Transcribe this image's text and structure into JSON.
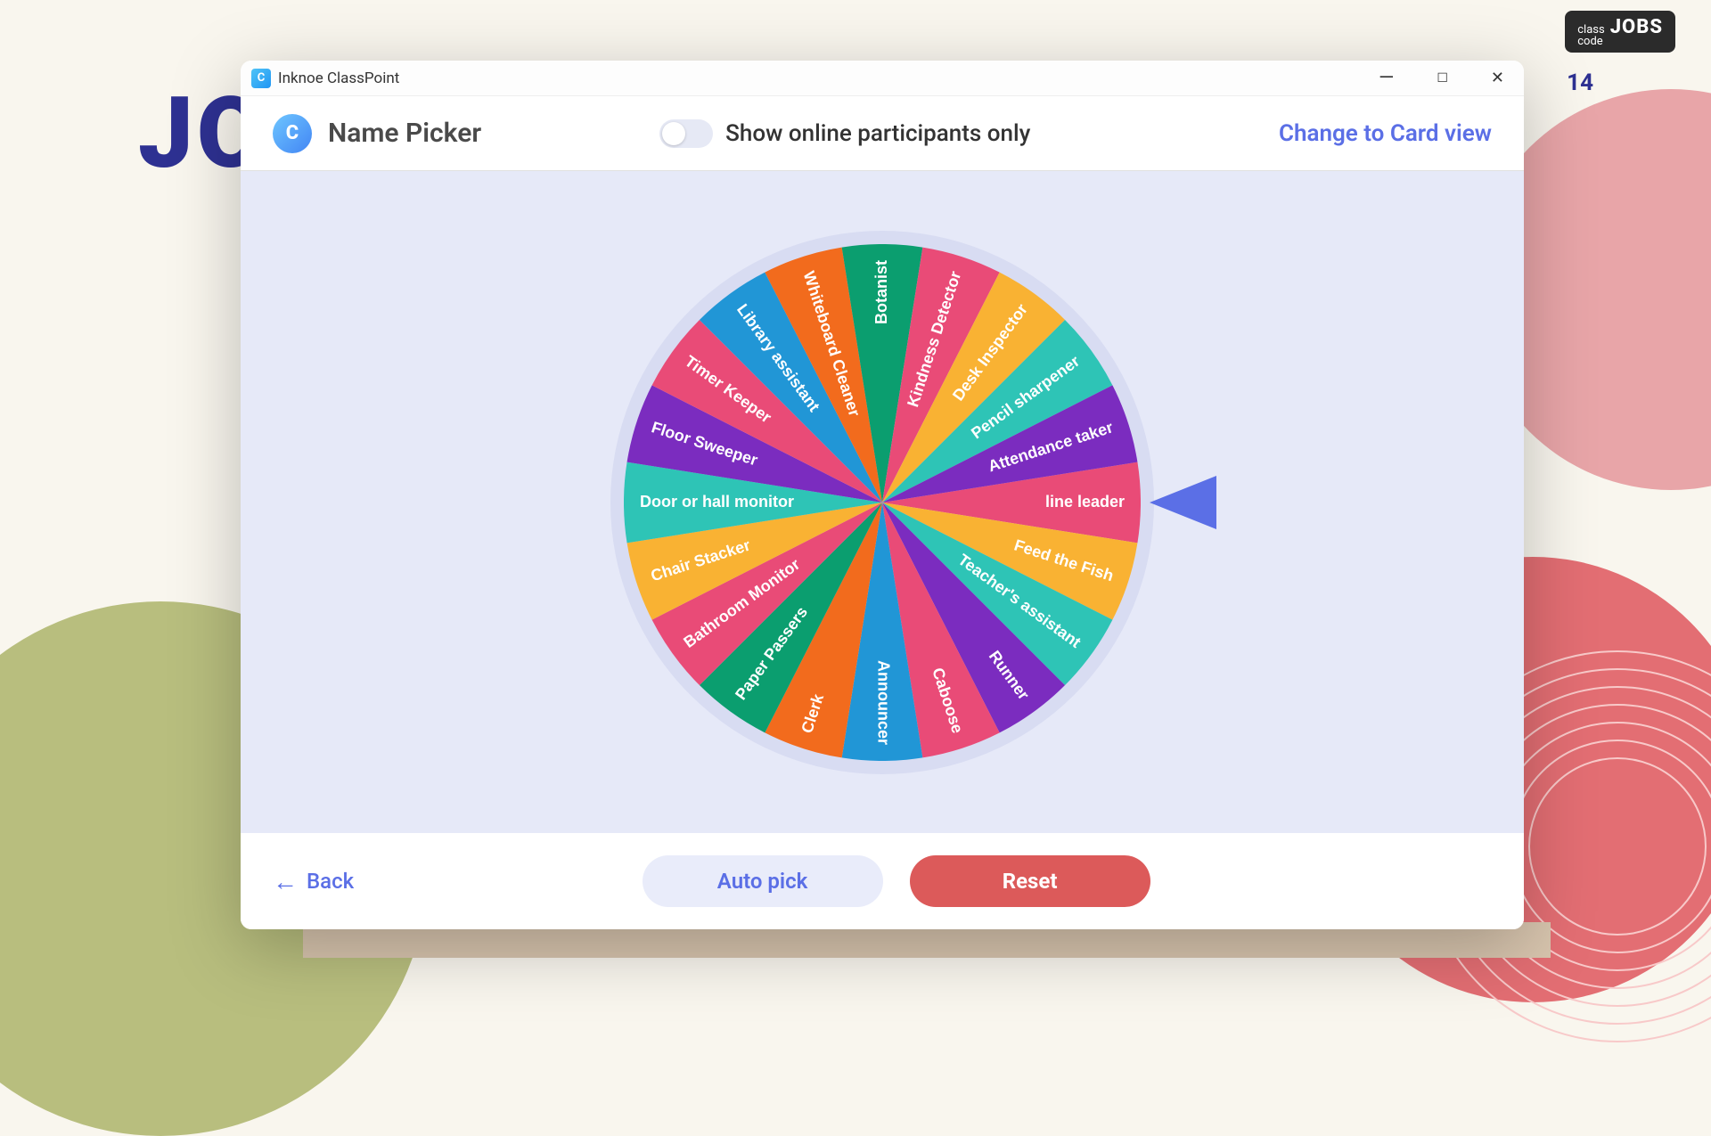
{
  "background": {
    "big_text": "JO",
    "chip_small": "class\ncode",
    "chip_big": "JOBS",
    "count": "14"
  },
  "titlebar": {
    "title": "Inknoe ClassPoint",
    "icon_letter": "C"
  },
  "header": {
    "logo_letter": "C",
    "title": "Name Picker",
    "toggle_label": "Show online participants only",
    "change_view": "Change to Card view"
  },
  "wheel": {
    "slices": [
      {
        "label": "line leader",
        "color": "#E94B77"
      },
      {
        "label": "Feed the Fish",
        "color": "#F9B233"
      },
      {
        "label": "Teacher's assistant",
        "color": "#2EC4B6"
      },
      {
        "label": "Runner",
        "color": "#7B2CBF"
      },
      {
        "label": "Caboose",
        "color": "#E94B77"
      },
      {
        "label": "Announcer",
        "color": "#2196D6"
      },
      {
        "label": "Clerk",
        "color": "#F26B1D"
      },
      {
        "label": "Paper Passers",
        "color": "#0B9E6F"
      },
      {
        "label": "Bathroom Monitor",
        "color": "#E94B77"
      },
      {
        "label": "Chair Stacker",
        "color": "#F9B233"
      },
      {
        "label": "Door or hall monitor",
        "color": "#2EC4B6"
      },
      {
        "label": "Floor Sweeper",
        "color": "#7B2CBF"
      },
      {
        "label": "Timer Keeper",
        "color": "#E94B77"
      },
      {
        "label": "Library assistant",
        "color": "#2196D6"
      },
      {
        "label": "Whiteboard Cleaner",
        "color": "#F26B1D"
      },
      {
        "label": "Botanist",
        "color": "#0B9E6F"
      },
      {
        "label": "Kindness Detector",
        "color": "#E94B77"
      },
      {
        "label": "Desk Inspector",
        "color": "#F9B233"
      },
      {
        "label": "Pencil sharpener",
        "color": "#2EC4B6"
      },
      {
        "label": "Attendance taker",
        "color": "#7B2CBF"
      }
    ]
  },
  "footer": {
    "back": "Back",
    "autopick": "Auto pick",
    "reset": "Reset"
  }
}
